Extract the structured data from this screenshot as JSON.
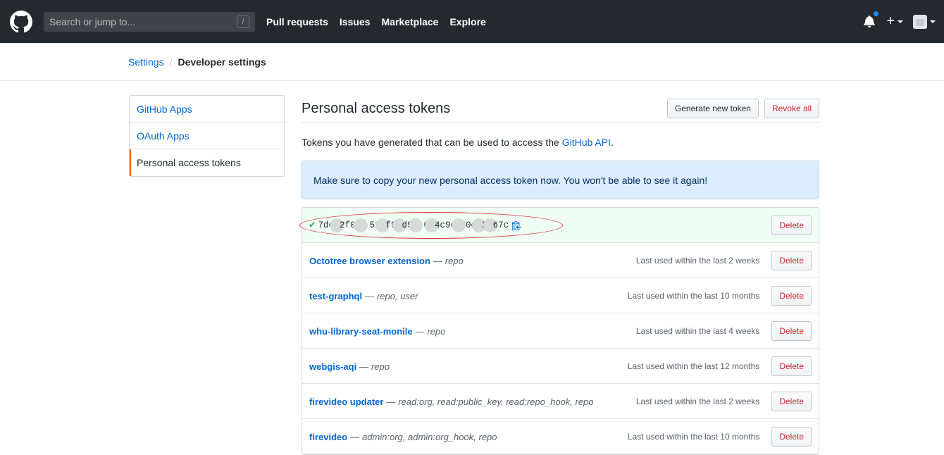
{
  "header": {
    "search_placeholder": "Search or jump to...",
    "search_shortcut": "/",
    "nav": [
      "Pull requests",
      "Issues",
      "Marketplace",
      "Explore"
    ],
    "plus_label": "+"
  },
  "breadcrumb": {
    "parent": "Settings",
    "separator": "/",
    "current": "Developer settings"
  },
  "sidebar": {
    "items": [
      {
        "label": "GitHub Apps"
      },
      {
        "label": "OAuth Apps"
      },
      {
        "label": "Personal access tokens"
      }
    ]
  },
  "main": {
    "title": "Personal access tokens",
    "generate_label": "Generate new token",
    "revoke_label": "Revoke all",
    "desc_prefix": "Tokens you have generated that can be used to access the ",
    "desc_link": "GitHub API",
    "desc_suffix": ".",
    "flash": "Make sure to copy your new personal access token now. You won't be able to see it again!"
  },
  "new_token": {
    "segments": [
      "7de",
      "2f0",
      "52",
      "f9",
      "d9",
      "0",
      "4c9e",
      "0c",
      "2",
      "67c"
    ],
    "delete_label": "Delete"
  },
  "tokens": [
    {
      "name": "Octotree browser extension",
      "dash": "—",
      "scopes": "repo",
      "last_used": "Last used within the last 2 weeks",
      "delete": "Delete"
    },
    {
      "name": "test-graphql",
      "dash": "—",
      "scopes": "repo, user",
      "last_used": "Last used within the last 10 months",
      "delete": "Delete"
    },
    {
      "name": "whu-library-seat-monile",
      "dash": "—",
      "scopes": "repo",
      "last_used": "Last used within the last 4 weeks",
      "delete": "Delete"
    },
    {
      "name": "webgis-aqi",
      "dash": "—",
      "scopes": "repo",
      "last_used": "Last used within the last 12 months",
      "delete": "Delete"
    },
    {
      "name": "firevideo updater",
      "dash": "—",
      "scopes": "read:org, read:public_key, read:repo_hook, repo",
      "last_used": "Last used within the last 2 weeks",
      "delete": "Delete"
    },
    {
      "name": "firevideo",
      "dash": "—",
      "scopes": "admin:org, admin:org_hook, repo",
      "last_used": "Last used within the last 10 months",
      "delete": "Delete"
    }
  ],
  "colors": {
    "header_bg": "#24292e",
    "link": "#0366d6",
    "danger": "#cb2431",
    "selected_border": "#e36209",
    "flash_bg": "#dbedff",
    "success": "#28a745"
  }
}
